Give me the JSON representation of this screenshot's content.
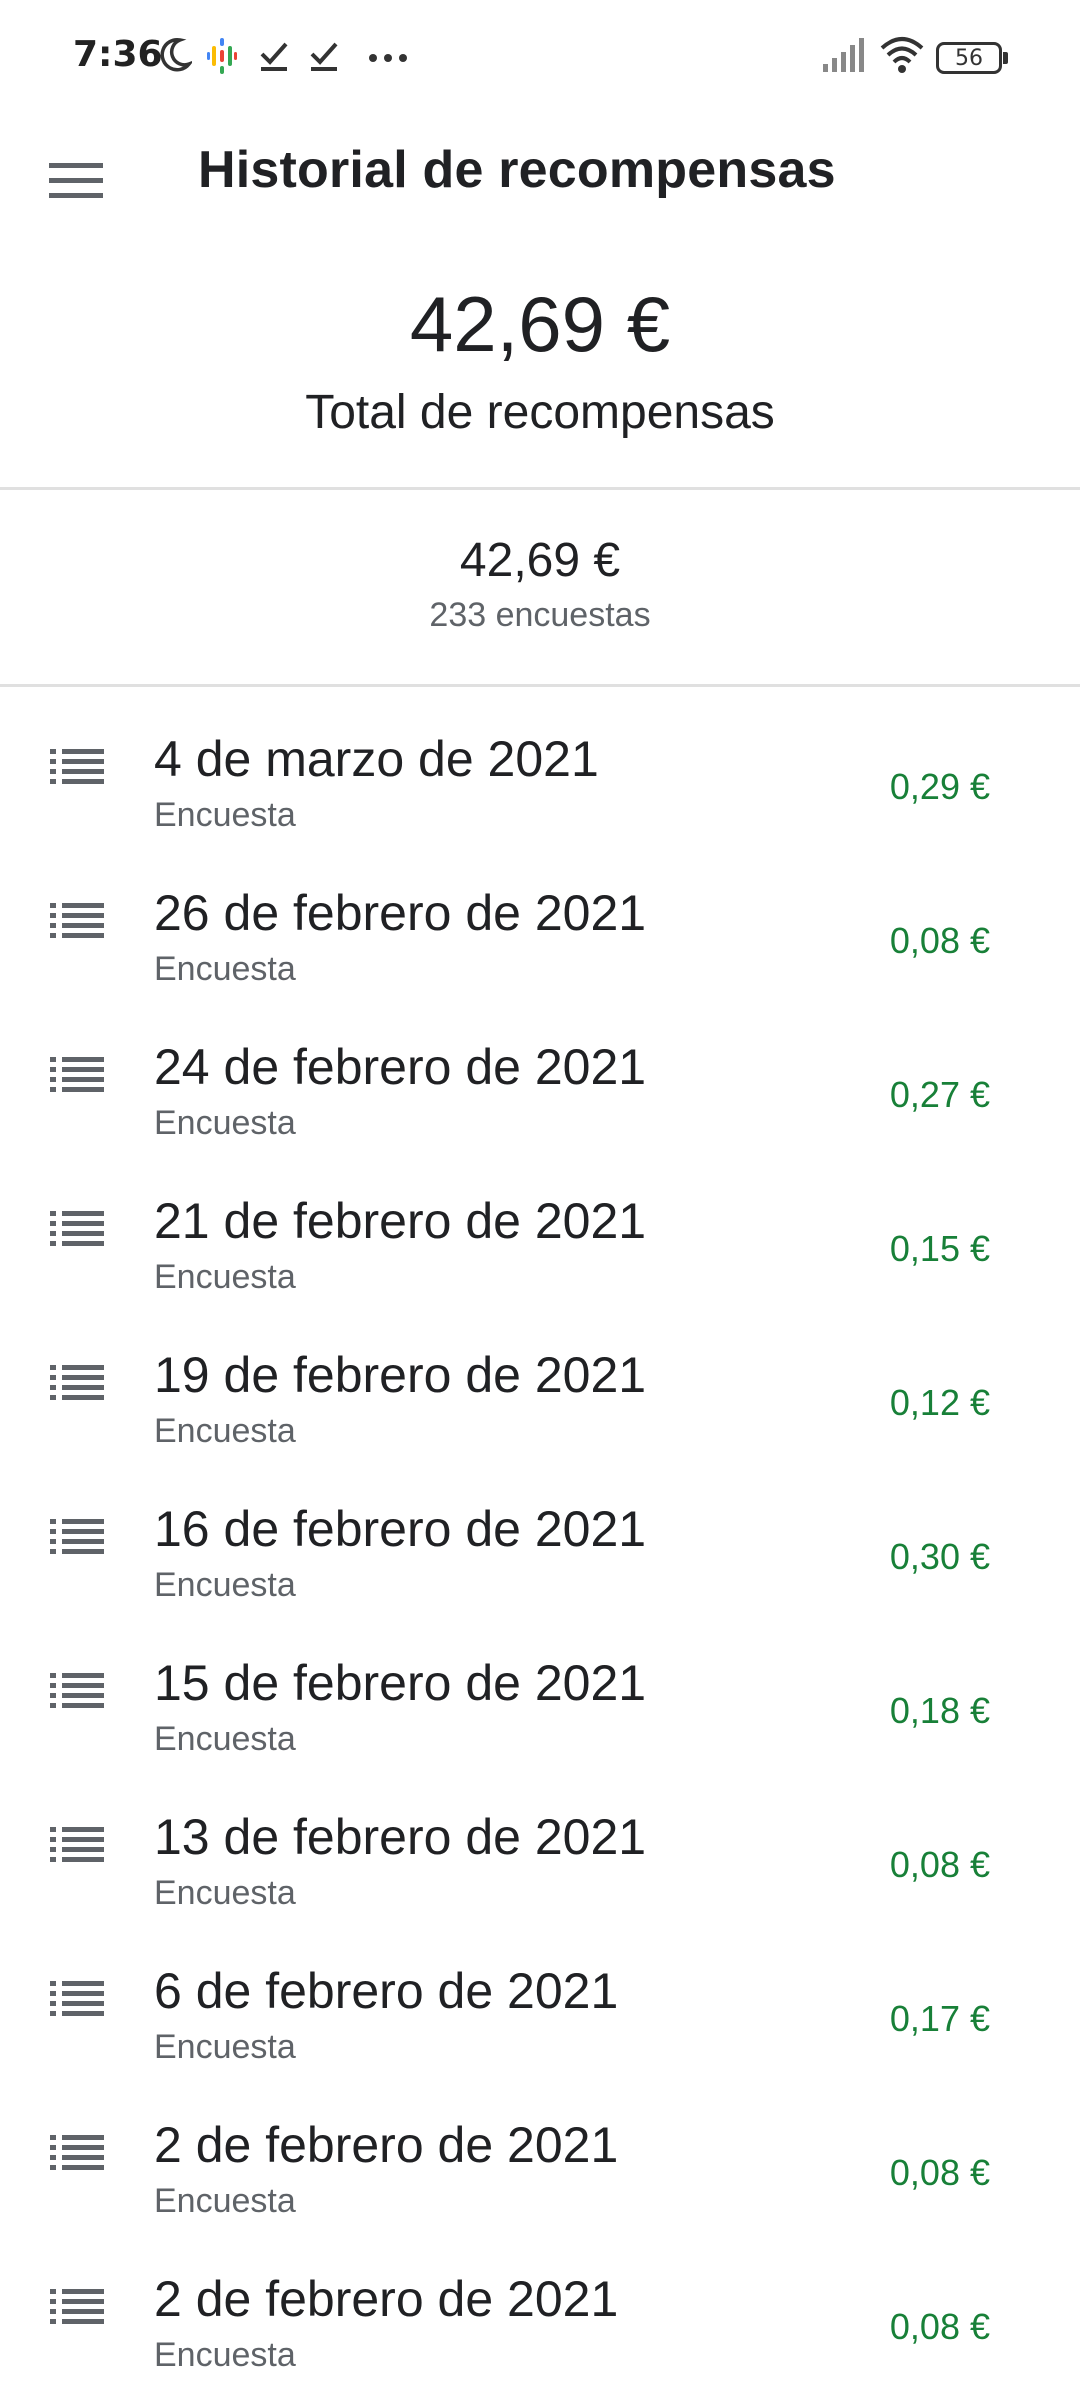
{
  "status_bar": {
    "time": "7:36",
    "battery": "56",
    "icons": [
      "moon-icon",
      "google-podcasts-icon",
      "check-icon",
      "check-icon",
      "more-dots-icon",
      "signal-icon",
      "wifi-icon",
      "battery-icon"
    ]
  },
  "app_bar": {
    "title": "Historial de recompensas",
    "menu_icon": "hamburger-menu-icon"
  },
  "total": {
    "amount": "42,69 €",
    "label": "Total de recompensas"
  },
  "summary": {
    "amount": "42,69 €",
    "count": "233 encuestas"
  },
  "colors": {
    "amount_green": "#188038",
    "text_primary": "#202124",
    "text_secondary": "#5f6368"
  },
  "rewards": [
    {
      "date": "4 de marzo de 2021",
      "type": "Encuesta",
      "amount": "0,29 €"
    },
    {
      "date": "26 de febrero de 2021",
      "type": "Encuesta",
      "amount": "0,08 €"
    },
    {
      "date": "24 de febrero de 2021",
      "type": "Encuesta",
      "amount": "0,27 €"
    },
    {
      "date": "21 de febrero de 2021",
      "type": "Encuesta",
      "amount": "0,15 €"
    },
    {
      "date": "19 de febrero de 2021",
      "type": "Encuesta",
      "amount": "0,12 €"
    },
    {
      "date": "16 de febrero de 2021",
      "type": "Encuesta",
      "amount": "0,30 €"
    },
    {
      "date": "15 de febrero de 2021",
      "type": "Encuesta",
      "amount": "0,18 €"
    },
    {
      "date": "13 de febrero de 2021",
      "type": "Encuesta",
      "amount": "0,08 €"
    },
    {
      "date": "6 de febrero de 2021",
      "type": "Encuesta",
      "amount": "0,17 €"
    },
    {
      "date": "2 de febrero de 2021",
      "type": "Encuesta",
      "amount": "0,08 €"
    },
    {
      "date": "2 de febrero de 2021",
      "type": "Encuesta",
      "amount": "0,08 €"
    }
  ]
}
